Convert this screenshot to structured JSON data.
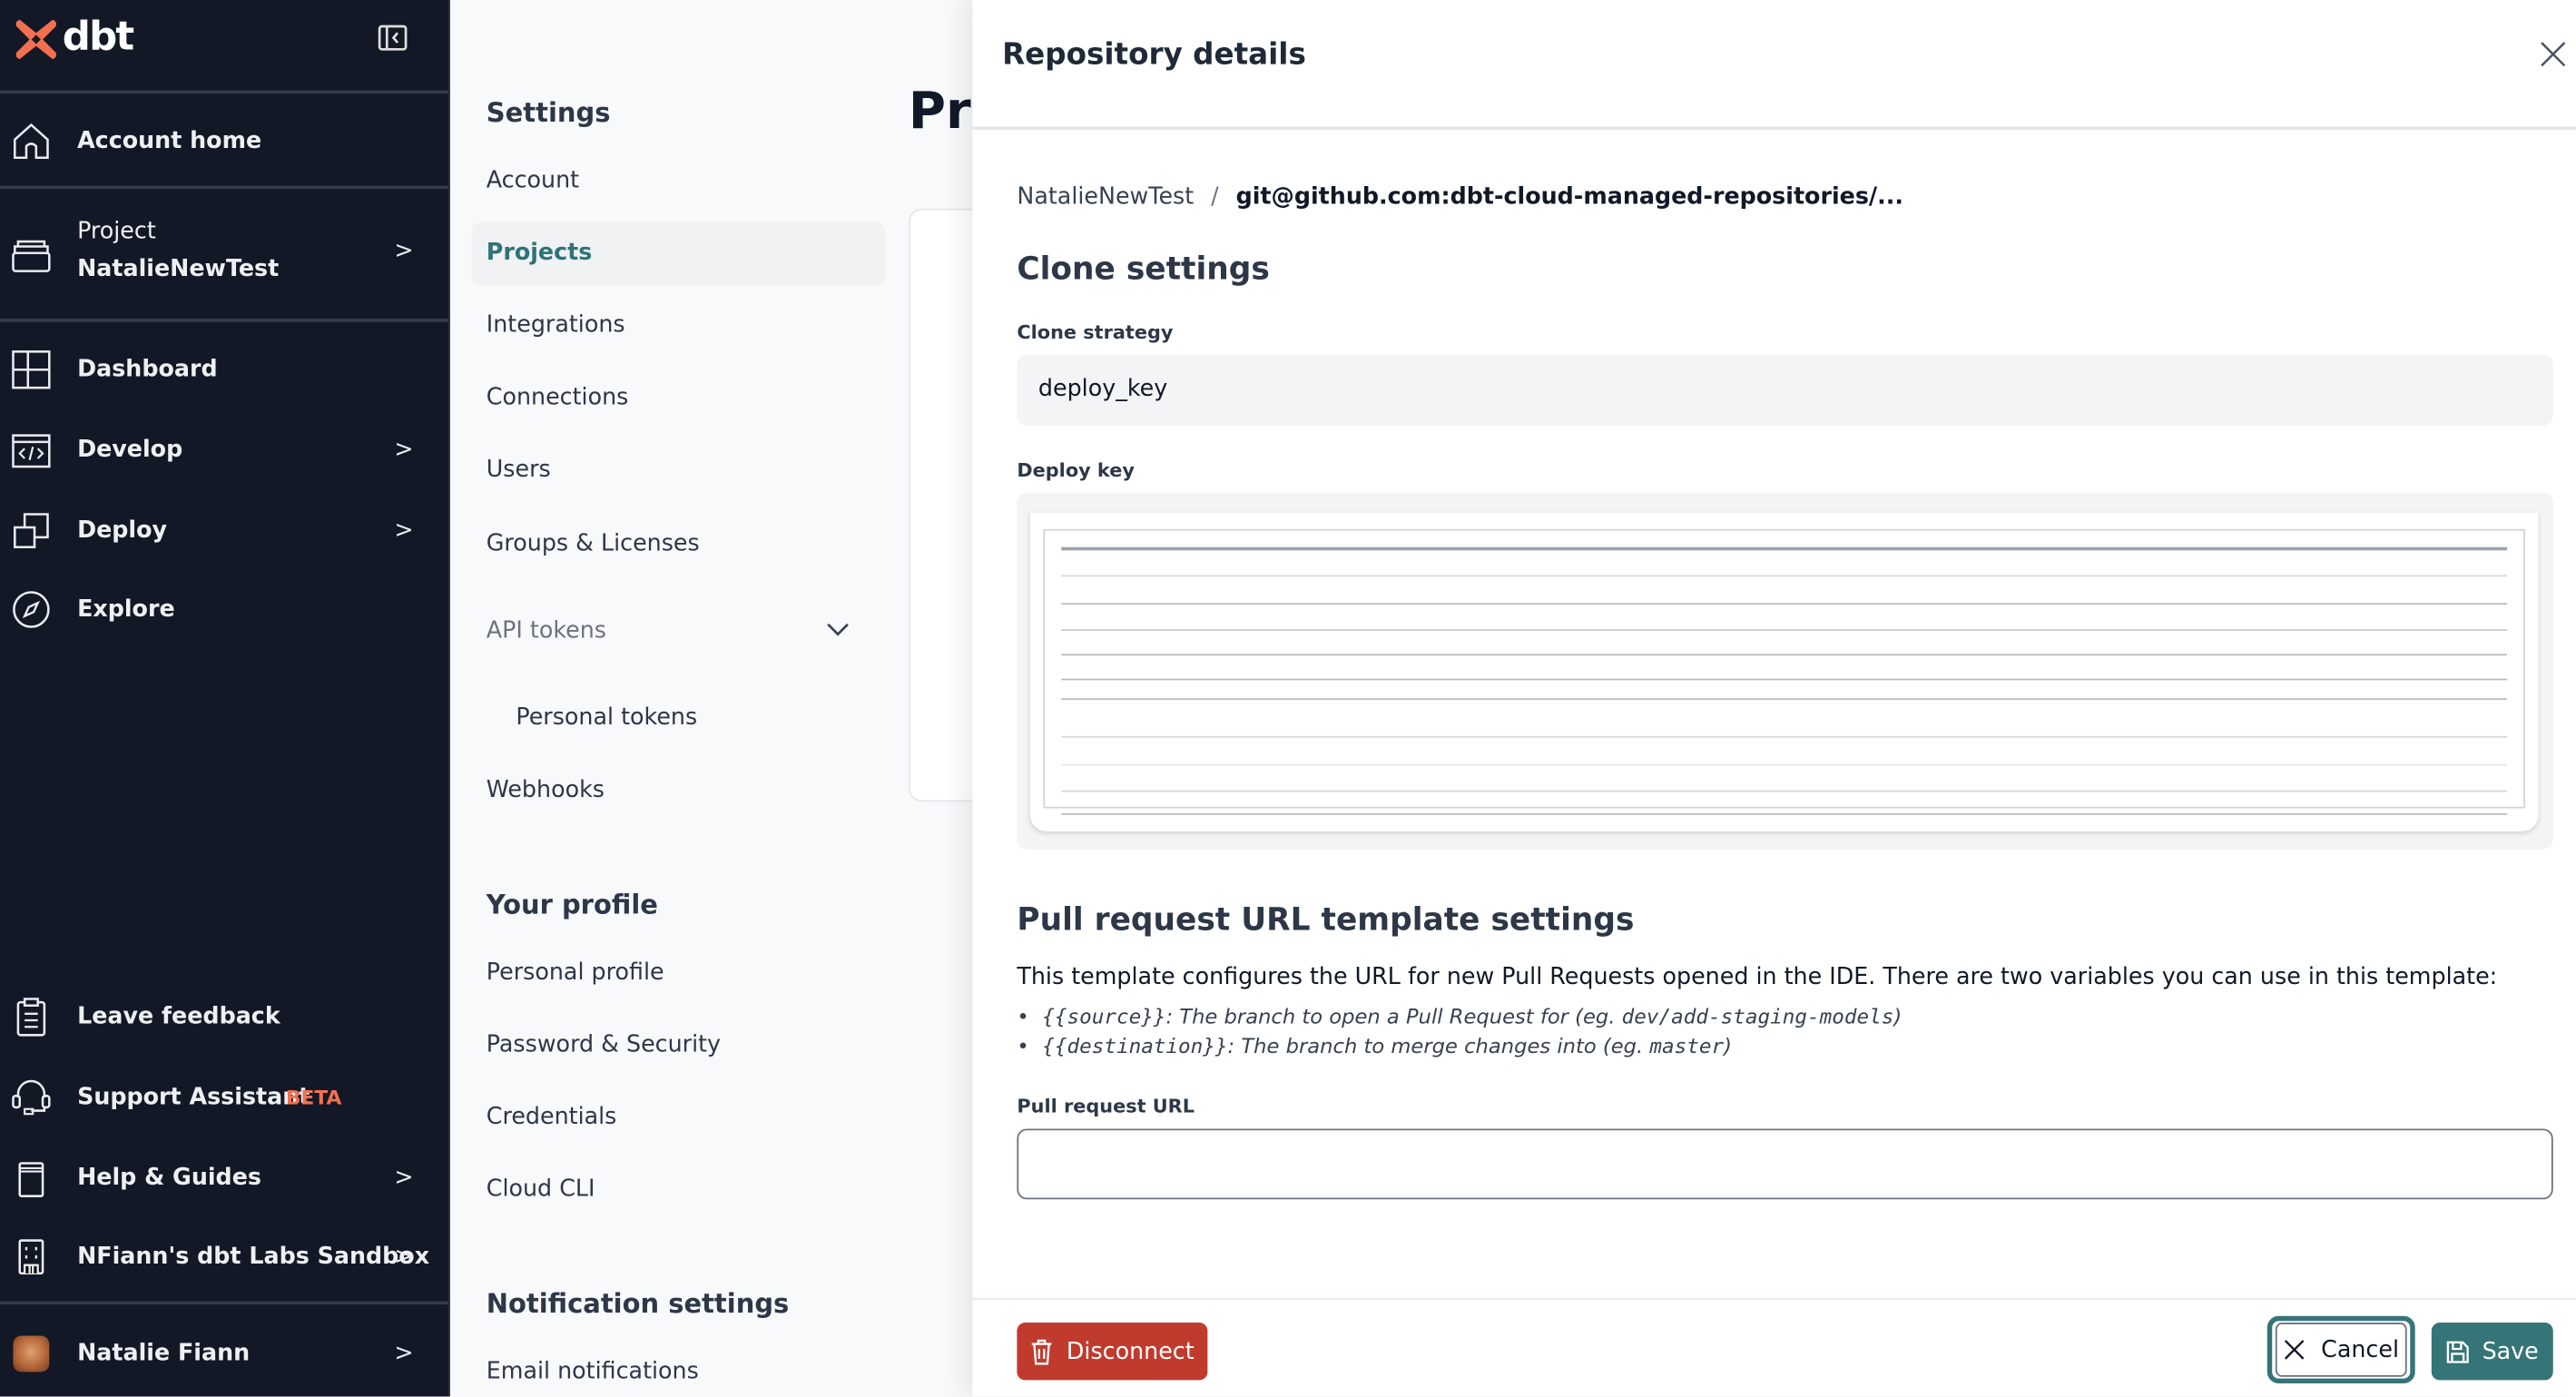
{
  "brand": {
    "logo_text": "dbt",
    "logo_color": "#f2704f"
  },
  "sidebar": {
    "collapse_icon": "sidebar-collapse-icon",
    "items": [
      {
        "label": "Account home",
        "icon": "home-icon"
      },
      {
        "label_top": "Project",
        "label": "NatalieNewTest",
        "icon": "layers-icon"
      },
      {
        "label": "Dashboard",
        "icon": "dashboard-icon"
      },
      {
        "label": "Develop",
        "icon": "code-icon"
      },
      {
        "label": "Deploy",
        "icon": "deploy-icon"
      },
      {
        "label": "Explore",
        "icon": "compass-icon"
      },
      {
        "label": "Leave feedback",
        "icon": "clipboard-icon"
      },
      {
        "label": "Support Assistant",
        "badge": "BETA",
        "icon": "headset-icon"
      },
      {
        "label": "Help & Guides",
        "icon": "book-icon"
      },
      {
        "label": "NFiann's dbt Labs Sandbox",
        "icon": "building-icon"
      },
      {
        "label": "Natalie Fiann",
        "icon": "avatar"
      }
    ]
  },
  "settings_nav": {
    "heading": "Settings",
    "items": [
      "Account",
      "Projects",
      "Integrations",
      "Connections",
      "Users",
      "Groups & Licenses",
      "API tokens",
      "Personal tokens",
      "Webhooks"
    ],
    "active": "Projects",
    "profile_heading": "Your profile",
    "profile_items": [
      "Personal profile",
      "Password & Security",
      "Credentials",
      "Cloud CLI"
    ],
    "notifications_heading": "Notification settings",
    "notification_items": [
      "Email notifications"
    ]
  },
  "main": {
    "title_partial": "Pro"
  },
  "drawer": {
    "title": "Repository details",
    "breadcrumb": {
      "project": "NatalieNewTest",
      "separator": "/",
      "repo": "git@github.com:dbt-cloud-managed-repositories/..."
    },
    "clone_settings": {
      "heading": "Clone settings",
      "strategy_label": "Clone strategy",
      "strategy_value": "deploy_key",
      "deploy_key_label": "Deploy key"
    },
    "pr_settings": {
      "heading": "Pull request URL template settings",
      "description": "This template configures the URL for new Pull Requests opened in the IDE. There are two variables you can use in this template:",
      "vars": [
        {
          "name": "{{source}}",
          "text": ": The branch to open a Pull Request for (eg. ",
          "example": "dev/add-staging-models",
          "close": ")"
        },
        {
          "name": "{{destination}}",
          "text": ": The branch to merge changes into (eg. ",
          "example": "master",
          "close": ")"
        }
      ],
      "url_label": "Pull request URL",
      "url_value": ""
    },
    "footer": {
      "disconnect": "Disconnect",
      "cancel": "Cancel",
      "save": "Save"
    }
  },
  "colors": {
    "sidebar_bg": "#131827",
    "accent": "#357477",
    "danger": "#c13a2e",
    "beta": "#f2704f"
  }
}
